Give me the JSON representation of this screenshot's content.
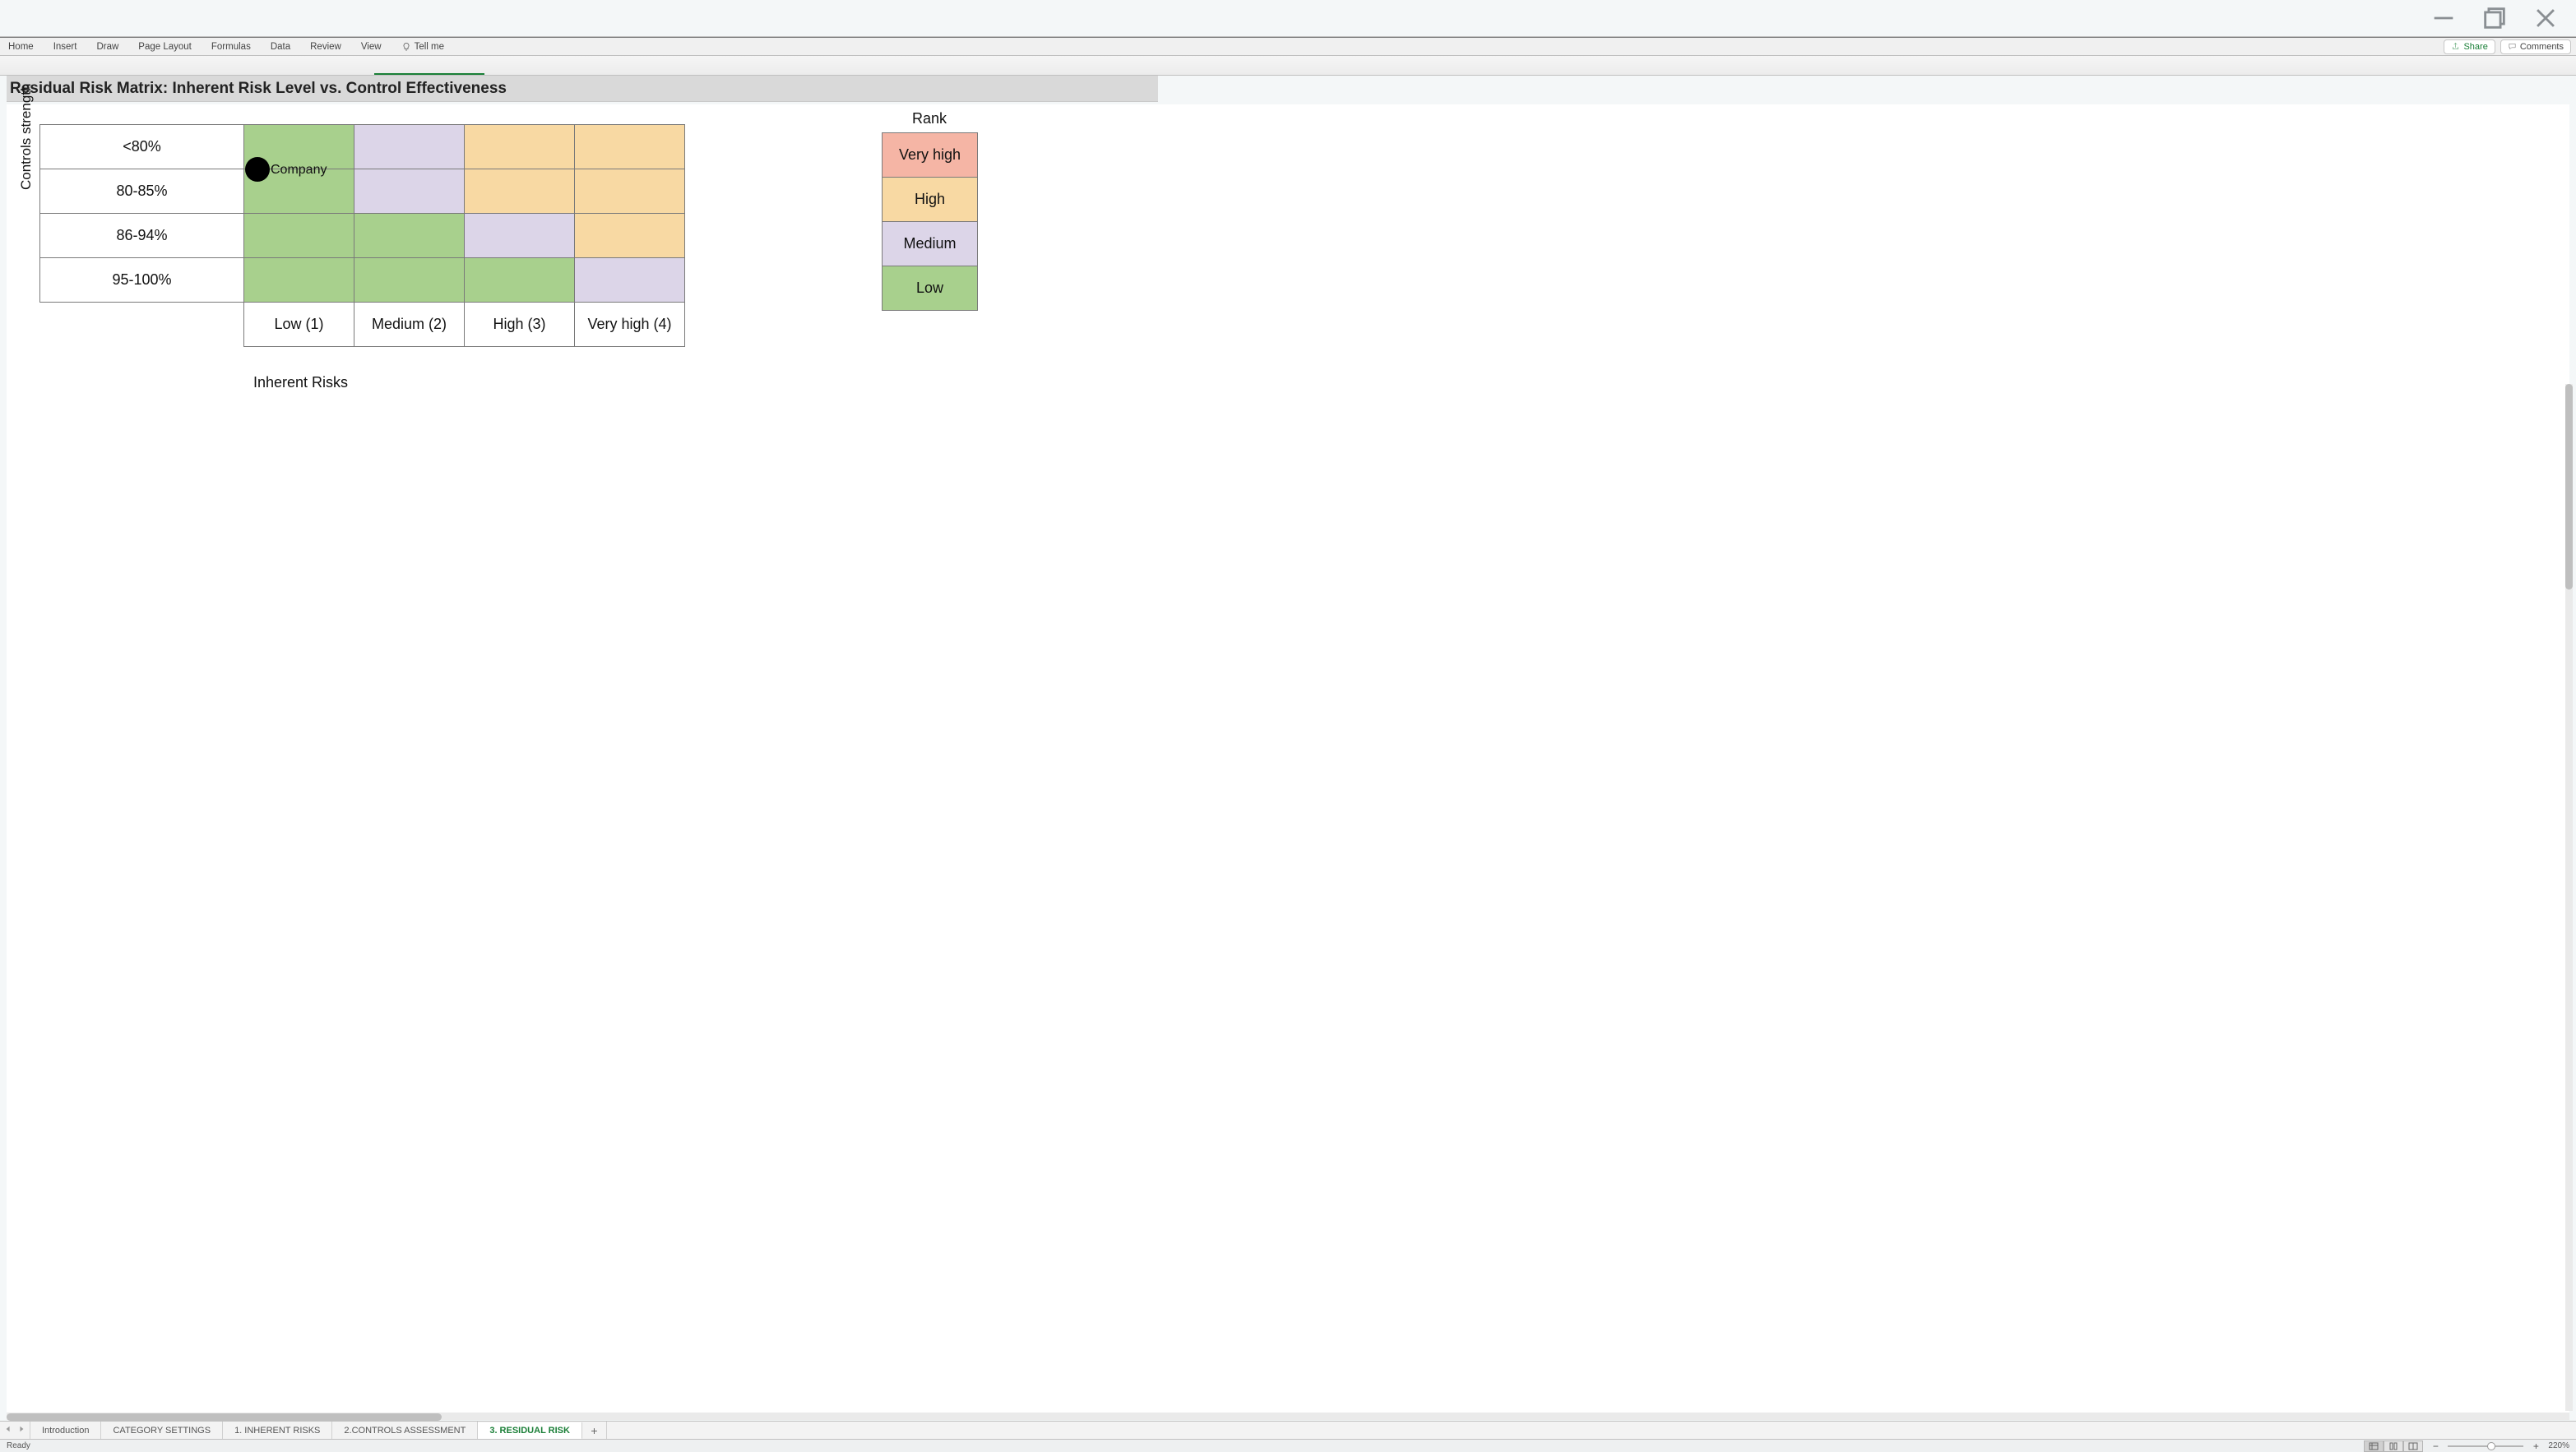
{
  "window": {
    "minimize": "minimize",
    "maximize": "maximize",
    "close": "close"
  },
  "ribbon": {
    "tabs": [
      "Home",
      "Insert",
      "Draw",
      "Page Layout",
      "Formulas",
      "Data",
      "Review",
      "View"
    ],
    "tellme": "Tell me",
    "share": "Share",
    "comments": "Comments"
  },
  "page_title": "Residual Risk Matrix: Inherent Risk Level vs. Control Effectiveness",
  "matrix": {
    "y_axis_label": "Controls strength",
    "x_axis_label": "Inherent Risks",
    "row_headers": [
      "<80%",
      "80-85%",
      "86-94%",
      "95-100%"
    ],
    "col_headers": [
      "Low (1)",
      "Medium (2)",
      "High (3)",
      "Very high (4)"
    ],
    "marker_label": "Company"
  },
  "rank": {
    "title": "Rank",
    "levels": [
      "Very high",
      "High",
      "Medium",
      "Low"
    ]
  },
  "sheets": {
    "tabs": [
      "Introduction",
      "CATEGORY SETTINGS",
      "1. INHERENT RISKS",
      "2.CONTROLS ASSESSMENT",
      "3. RESIDUAL RISK"
    ],
    "active_index": 4,
    "add": "+"
  },
  "statusbar": {
    "ready": "Ready",
    "zoom": "220%"
  },
  "chart_data": {
    "type": "heatmap",
    "title": "Residual Risk Matrix: Inherent Risk Level vs. Control Effectiveness",
    "xlabel": "Inherent Risks",
    "ylabel": "Controls strength",
    "x_categories": [
      "Low (1)",
      "Medium (2)",
      "High (3)",
      "Very high (4)"
    ],
    "y_categories": [
      "<80%",
      "80-85%",
      "86-94%",
      "95-100%"
    ],
    "cells": [
      [
        "Low",
        "Medium",
        "High",
        "High"
      ],
      [
        "Low",
        "Medium",
        "High",
        "High"
      ],
      [
        "Low",
        "Low",
        "Medium",
        "High"
      ],
      [
        "Low",
        "Low",
        "Low",
        "Medium"
      ]
    ],
    "legend": {
      "Low": "#a8d08d",
      "Medium": "#dcd5e8",
      "High": "#f8d9a3",
      "Very high": "#f5b5a5"
    },
    "markers": [
      {
        "label": "Company",
        "x": "Low (1)",
        "y": "<80%"
      }
    ]
  }
}
